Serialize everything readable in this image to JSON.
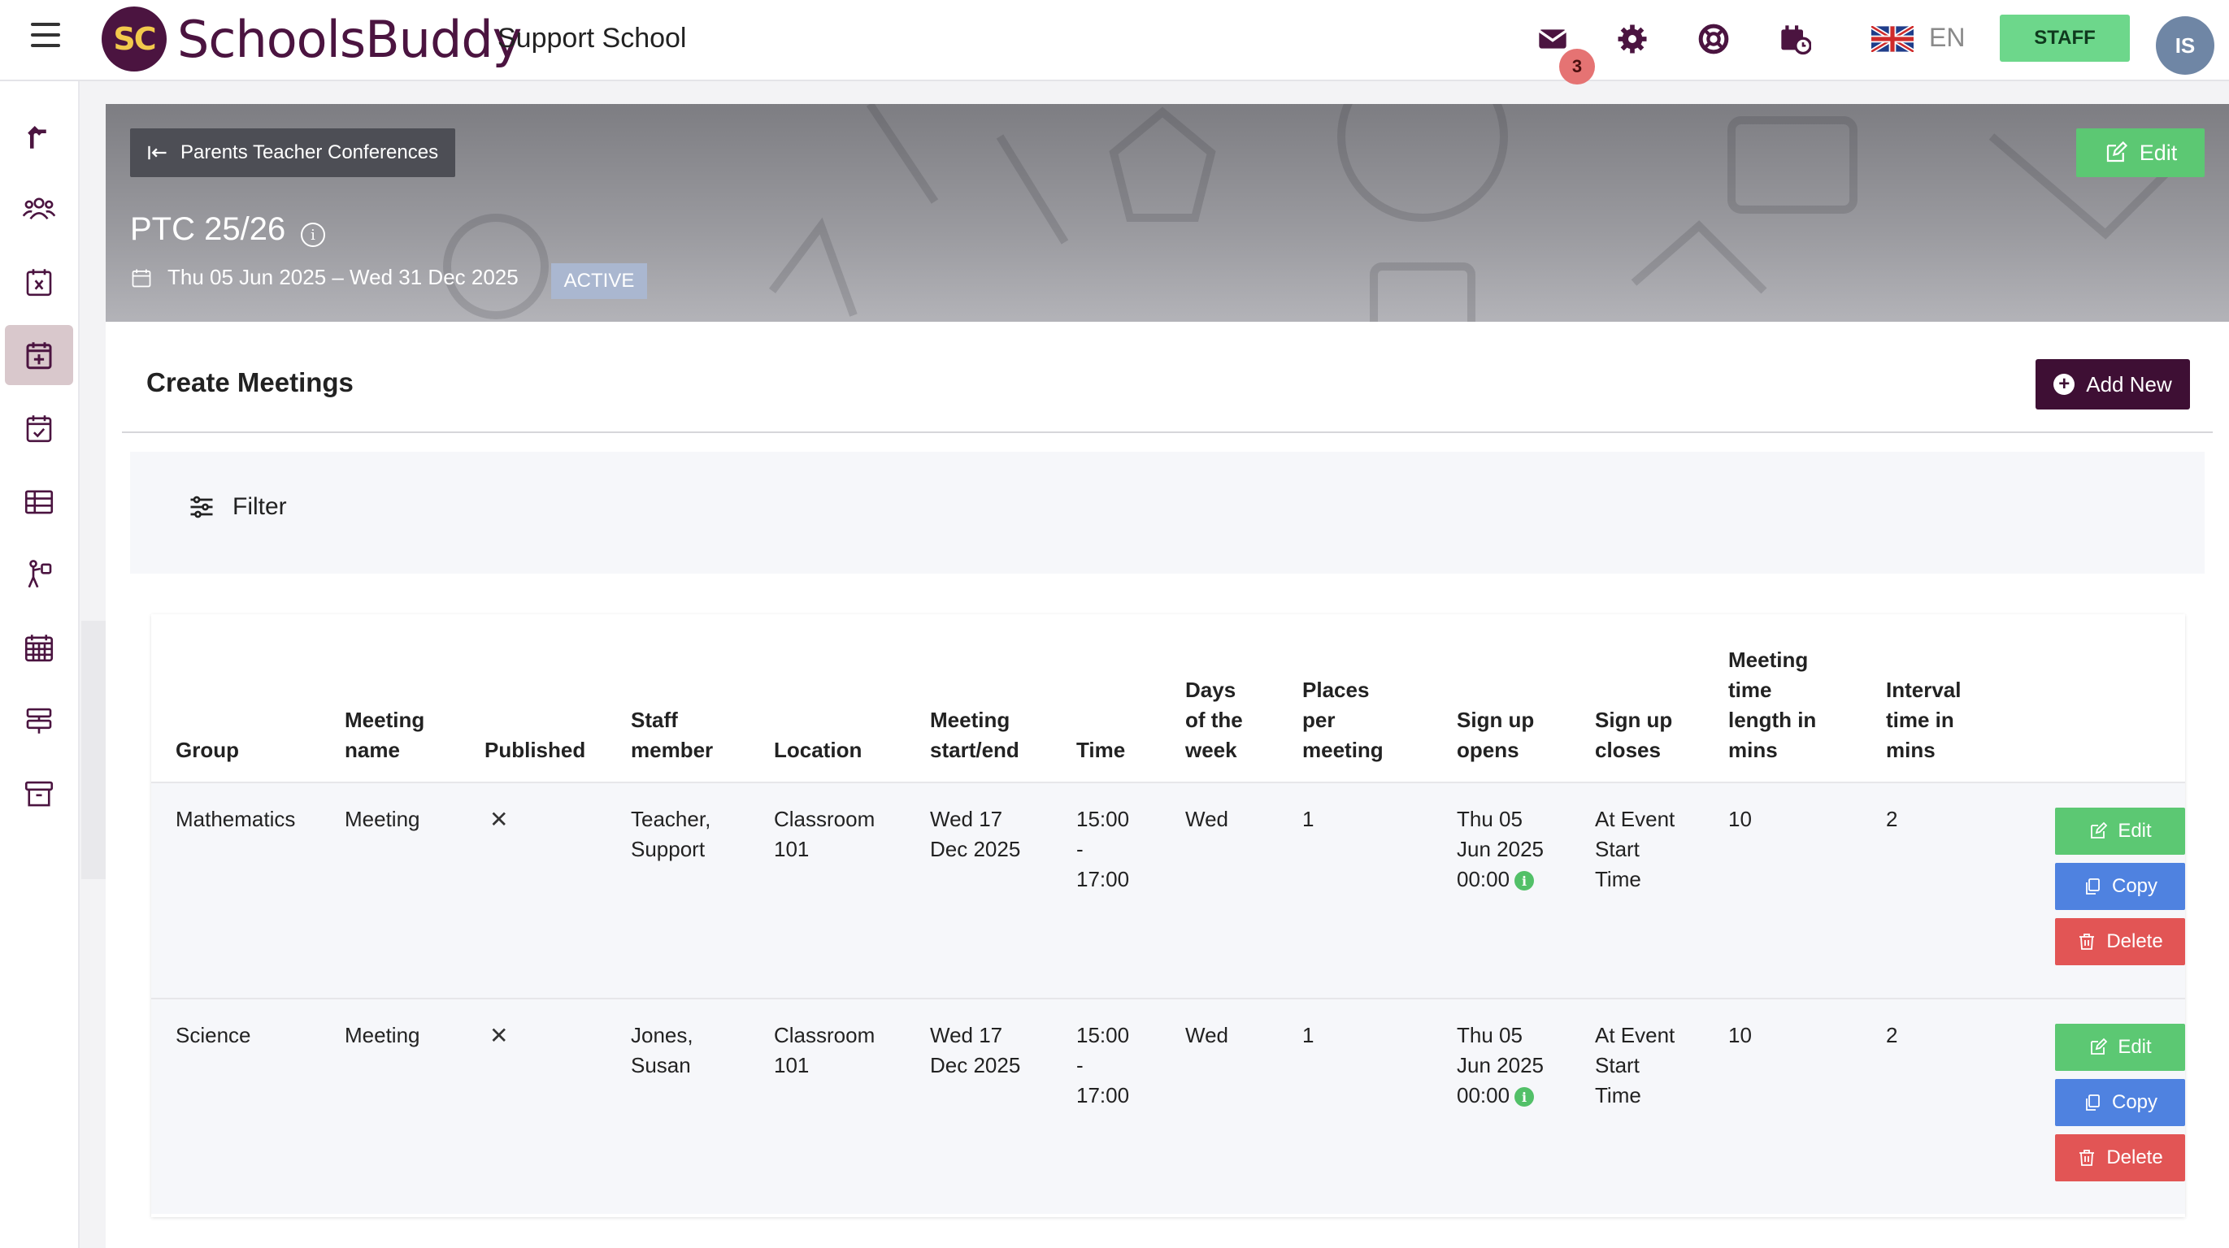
{
  "header": {
    "logo_mark": "SC",
    "brand": "SchoolsBuddy",
    "school": "Support School",
    "mail_badge": "3",
    "language": "EN",
    "role_button": "STAFF",
    "user_initials": "IS"
  },
  "banner": {
    "back_label": "Parents Teacher Conferences",
    "title": "PTC 25/26",
    "info_glyph": "i",
    "dates": "Thu 05 Jun 2025 – Wed 31 Dec 2025",
    "status": "ACTIVE",
    "edit_label": "Edit"
  },
  "section": {
    "title": "Create Meetings",
    "add_new": "Add New",
    "filter": "Filter"
  },
  "table": {
    "columns": [
      "Group",
      "Meeting name",
      "Published",
      "Staff member",
      "Location",
      "Meeting start/end",
      "Time",
      "Days of the week",
      "Places per meeting",
      "Sign up opens",
      "Sign up closes",
      "Meeting time length in mins",
      "Interval time in mins"
    ],
    "rows": [
      {
        "group": "Mathematics",
        "meeting_name": "Meeting",
        "published": "✕",
        "staff_1": "Teacher,",
        "staff_2": "Support",
        "loc_1": "Classroom",
        "loc_2": "101",
        "date_1": "Wed 17",
        "date_2": "Dec 2025",
        "time_1": "15:00",
        "time_2": "-",
        "time_3": "17:00",
        "days": "Wed",
        "places": "1",
        "opens_1": "Thu 05",
        "opens_2": "Jun 2025",
        "opens_3": "00:00",
        "closes_1": "At Event",
        "closes_2": "Start",
        "closes_3": "Time",
        "length": "10",
        "interval": "2",
        "edit": "Edit",
        "copy": "Copy",
        "delete": "Delete"
      },
      {
        "group": "Science",
        "meeting_name": "Meeting",
        "published": "✕",
        "staff_1": "Jones,",
        "staff_2": "Susan",
        "loc_1": "Classroom",
        "loc_2": "101",
        "date_1": "Wed 17",
        "date_2": "Dec 2025",
        "time_1": "15:00",
        "time_2": "-",
        "time_3": "17:00",
        "days": "Wed",
        "places": "1",
        "opens_1": "Thu 05",
        "opens_2": "Jun 2025",
        "opens_3": "00:00",
        "closes_1": "At Event",
        "closes_2": "Start",
        "closes_3": "Time",
        "length": "10",
        "interval": "2",
        "edit": "Edit",
        "copy": "Copy",
        "delete": "Delete"
      }
    ]
  },
  "sidebar": {
    "items": [
      "export-icon",
      "people-icon",
      "calendar-x-icon",
      "calendar-plus-icon",
      "calendar-check-icon",
      "table-icon",
      "activity-icon",
      "calendar-grid-icon",
      "signpost-icon",
      "archive-icon"
    ],
    "active_index": 3
  },
  "colors": {
    "brand": "#4b1440",
    "staff_green": "#6dd78b",
    "edit_green": "#5cc873",
    "copy_blue": "#4f82e0",
    "delete_red": "#e25555",
    "add_new": "#3e0f34"
  }
}
